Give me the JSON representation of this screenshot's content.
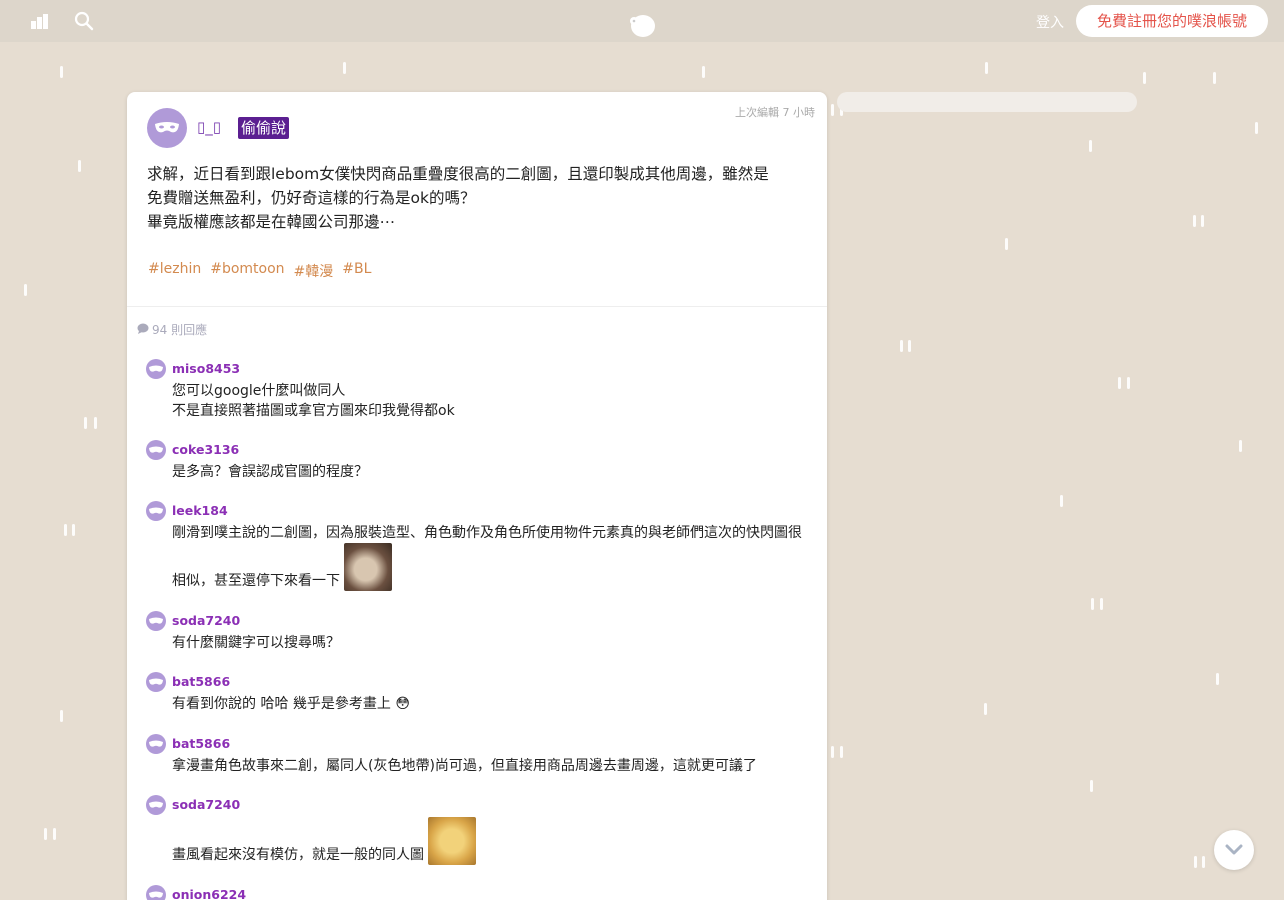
{
  "topbar": {
    "login_label": "登入",
    "signup_label": "免費註冊您的噗浪帳號"
  },
  "post": {
    "author": "▯_▯",
    "anon_badge": "偷偷說",
    "edited": "上次編輯 7 小時",
    "text_line1": "求解，近日看到跟lebom女僕快閃商品重疊度很高的二創圖，且還印製成其他周邊，雖然是",
    "text_line2": "免費贈送無盈利，仍好奇這樣的行為是ok的嗎？",
    "text_line3": "畢竟版權應該都是在韓國公司那邊⋯",
    "tags": [
      "#lezhin",
      "#bomtoon",
      "#韓漫",
      "#BL"
    ]
  },
  "replies_count": "94 則回應",
  "replies": [
    {
      "user": "miso8453",
      "line1": "您可以google什麼叫做同人",
      "line2": "不是直接照著描圖或拿官方圖來印我覺得都ok"
    },
    {
      "user": "coke3136",
      "line1": "是多高？會誤認成官圖的程度？"
    },
    {
      "user": "leek184",
      "line1": "剛滑到噗主說的二創圖，因為服裝造型、角色動作及角色所使用物件元素真的與老師們這次的快閃圖很",
      "line2": "相似，甚至還停下來看一下"
    },
    {
      "user": "soda7240",
      "line1": "有什麼關鍵字可以搜尋嗎？"
    },
    {
      "user": "bat5866",
      "line1": "有看到你說的 哈哈 幾乎是參考畫上 😳"
    },
    {
      "user": "bat5866",
      "line1": "拿漫畫角色故事來二創，屬同人(灰色地帶)尚可過，但直接用商品周邊去畫周邊，這就更可議了"
    },
    {
      "user": "soda7240",
      "line1": "畫風看起來沒有模仿，就是一般的同人圖"
    },
    {
      "user": "onion6224"
    }
  ],
  "colors": {
    "background": "#e6ddd1",
    "accent_purple": "#5b1f91",
    "username_purple": "#8b2fb5",
    "tag_orange": "#d38a4f",
    "signup_red": "#e4544b"
  }
}
